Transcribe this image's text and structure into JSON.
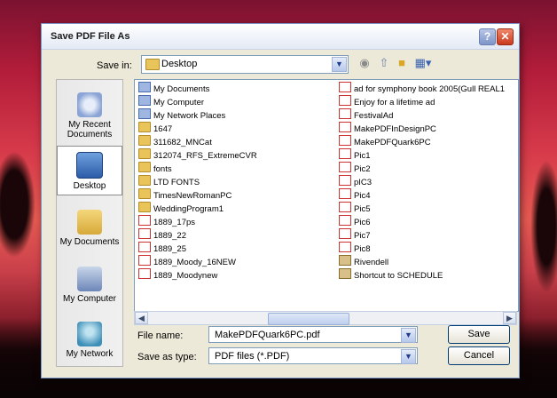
{
  "dialog": {
    "title": "Save PDF File As",
    "save_in_label": "Save in:",
    "save_in_value": "Desktop"
  },
  "places": [
    {
      "label": "My Recent\nDocuments",
      "icon": "recent-documents-icon"
    },
    {
      "label": "Desktop",
      "icon": "desktop-icon"
    },
    {
      "label": "My Documents",
      "icon": "my-documents-icon"
    },
    {
      "label": "My Computer",
      "icon": "my-computer-icon"
    },
    {
      "label": "My Network",
      "icon": "my-network-icon"
    }
  ],
  "files_left": [
    {
      "name": "My Documents",
      "type": "sys"
    },
    {
      "name": "My Computer",
      "type": "sys"
    },
    {
      "name": "My Network Places",
      "type": "sys"
    },
    {
      "name": "1647",
      "type": "folder"
    },
    {
      "name": "311682_MNCat",
      "type": "folder"
    },
    {
      "name": "312074_RFS_ExtremeCVR",
      "type": "folder"
    },
    {
      "name": "fonts",
      "type": "folder"
    },
    {
      "name": "LTD FONTS",
      "type": "folder"
    },
    {
      "name": "TimesNewRomanPC",
      "type": "folder"
    },
    {
      "name": "WeddingProgram1",
      "type": "folder"
    },
    {
      "name": "1889_17ps",
      "type": "pdf"
    },
    {
      "name": "1889_22",
      "type": "pdf"
    },
    {
      "name": "1889_25",
      "type": "pdf"
    },
    {
      "name": "1889_Moody_16NEW",
      "type": "pdf"
    },
    {
      "name": "1889_Moodynew",
      "type": "pdf"
    }
  ],
  "files_right": [
    {
      "name": "ad for symphony book 2005(Gull REAL1",
      "type": "pdf"
    },
    {
      "name": "Enjoy for a lifetime ad",
      "type": "pdf"
    },
    {
      "name": "FestivalAd",
      "type": "pdf"
    },
    {
      "name": "MakePDFInDesignPC",
      "type": "pdf"
    },
    {
      "name": "MakePDFQuark6PC",
      "type": "pdf"
    },
    {
      "name": "Pic1",
      "type": "pdf"
    },
    {
      "name": "Pic2",
      "type": "pdf"
    },
    {
      "name": "pIC3",
      "type": "pdf"
    },
    {
      "name": "Pic4",
      "type": "pdf"
    },
    {
      "name": "Pic5",
      "type": "pdf"
    },
    {
      "name": "Pic6",
      "type": "pdf"
    },
    {
      "name": "Pic7",
      "type": "pdf"
    },
    {
      "name": "Pic8",
      "type": "pdf"
    },
    {
      "name": "Rivendell",
      "type": "link"
    },
    {
      "name": "Shortcut to SCHEDULE",
      "type": "link"
    }
  ],
  "form": {
    "file_name_label": "File name:",
    "file_name_value": "MakePDFQuark6PC.pdf",
    "save_type_label": "Save as type:",
    "save_type_value": "PDF files (*.PDF)",
    "save_button": "Save",
    "cancel_button": "Cancel"
  }
}
